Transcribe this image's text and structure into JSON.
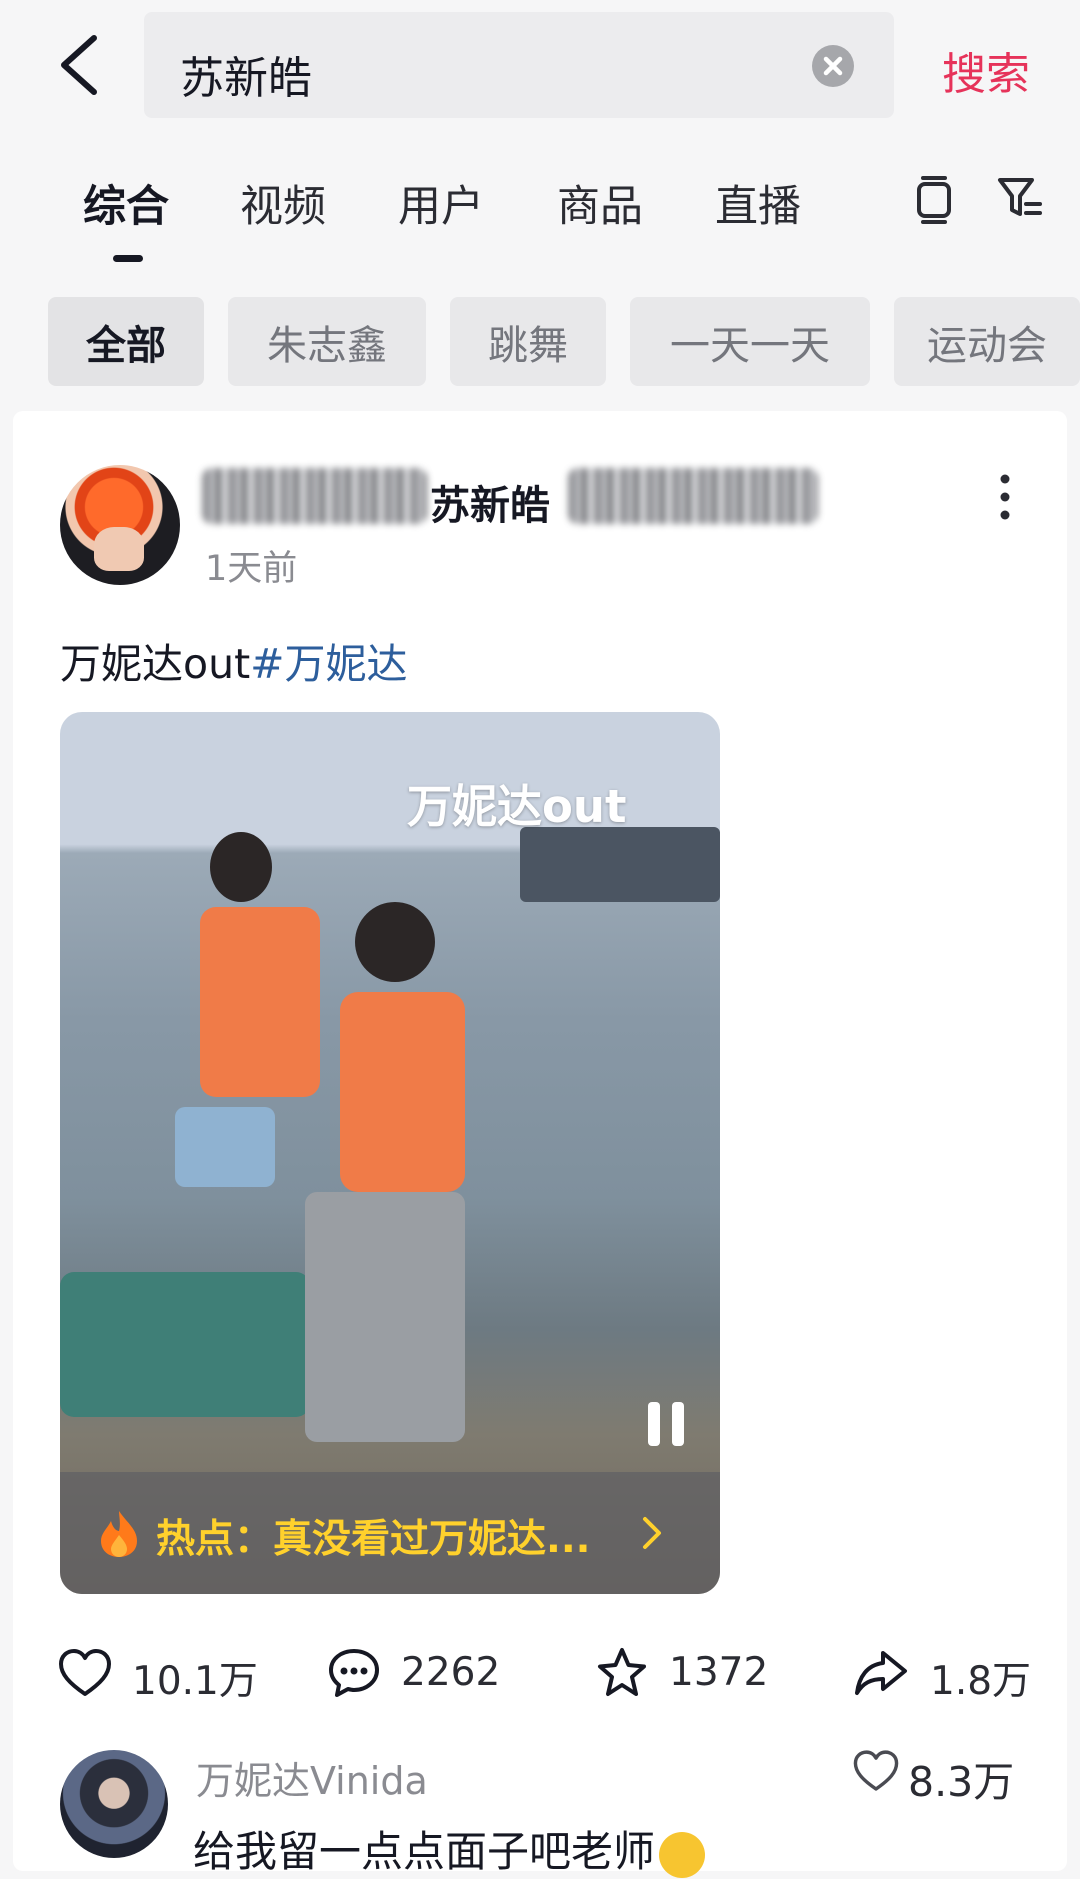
{
  "search": {
    "query": "苏新皓",
    "submit_label": "搜索"
  },
  "tabs": [
    {
      "label": "综合",
      "active": true
    },
    {
      "label": "视频"
    },
    {
      "label": "用户"
    },
    {
      "label": "商品"
    },
    {
      "label": "直播"
    }
  ],
  "chips": [
    {
      "label": "全部",
      "active": true
    },
    {
      "label": "朱志鑫"
    },
    {
      "label": "跳舞"
    },
    {
      "label": "一天一天"
    },
    {
      "label": "运动会"
    }
  ],
  "post": {
    "author_visible": "苏新皓",
    "time": "1天前",
    "caption_text": "万妮达out",
    "caption_tag": "#万妮达",
    "video": {
      "overlay_title": "万妮达out",
      "hot_text": "热点：真没看过万妮达..."
    },
    "stats": {
      "likes": "10.1万",
      "comments": "2262",
      "favorites": "1372",
      "shares": "1.8万"
    }
  },
  "comment": {
    "author": "万妮达Vinida",
    "likes": "8.3万",
    "text": "给我留一点点面子吧老师"
  },
  "colors": {
    "accent": "#e6335a",
    "hashtag": "#2d5e9c",
    "hot_text": "#ffd12c"
  }
}
